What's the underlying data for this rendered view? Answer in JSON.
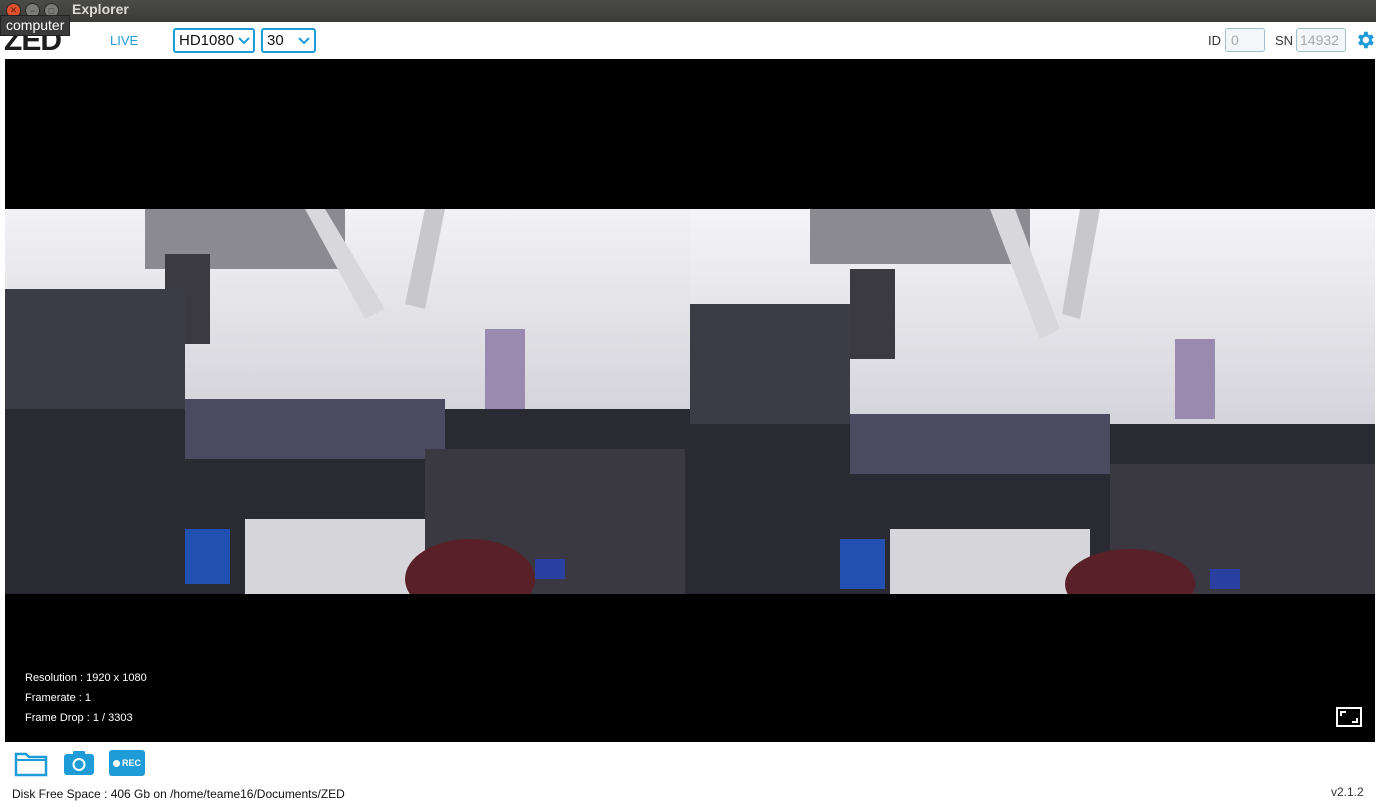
{
  "window": {
    "title": "Explorer",
    "tooltip": "computer"
  },
  "toolbar": {
    "logo": "ZED",
    "live_tab": "LIVE",
    "resolution_select": "HD1080",
    "fps_select": "30",
    "id_label": "ID",
    "id_value": "0",
    "sn_label": "SN",
    "sn_value": "14932",
    "settings_icon": "gear-icon"
  },
  "viewer": {
    "resolution": "Resolution : 1920 x 1080",
    "framerate": "Framerate : 1",
    "frame_drop": "Frame Drop : 1 / 3303",
    "fullscreen_icon": "fullscreen-icon"
  },
  "bottom": {
    "folder_icon": "folder-icon",
    "camera_icon": "camera-icon",
    "rec_label": "REC",
    "disk_free": "Disk Free Space : 406 Gb  on /home/teame16/Documents/ZED",
    "version": "v2.1.2"
  },
  "colors": {
    "accent": "#1e9cd7",
    "background": "#ffffff",
    "viewer": "#000000"
  }
}
